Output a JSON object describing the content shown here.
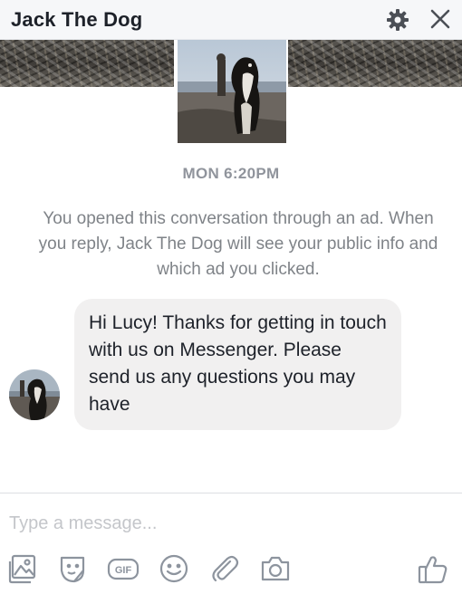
{
  "header": {
    "title": "Jack The Dog",
    "settings_icon": "gear-icon",
    "close_icon": "close-icon"
  },
  "conversation": {
    "timestamp": "MON 6:20PM",
    "ad_notice": "You opened this conversation through an ad. When you reply, Jack The Dog will see your public info and which ad you clicked.",
    "messages": [
      {
        "sender": "Jack The Dog",
        "text": "Hi Lucy! Thanks for getting in touch with us on Messenger. Please send us any questions you may have"
      }
    ]
  },
  "composer": {
    "placeholder": "Type a message..."
  },
  "toolbar": {
    "icons": [
      "photo-icon",
      "sticker-icon",
      "gif-icon",
      "emoji-icon",
      "attachment-icon",
      "camera-icon",
      "thumbs-up-icon"
    ],
    "gif_label": "GIF"
  },
  "colors": {
    "header_bg": "#f6f7f9",
    "bubble_bg": "#f1f0f0",
    "muted_text": "#90949c",
    "icon_gray": "#90949c"
  }
}
